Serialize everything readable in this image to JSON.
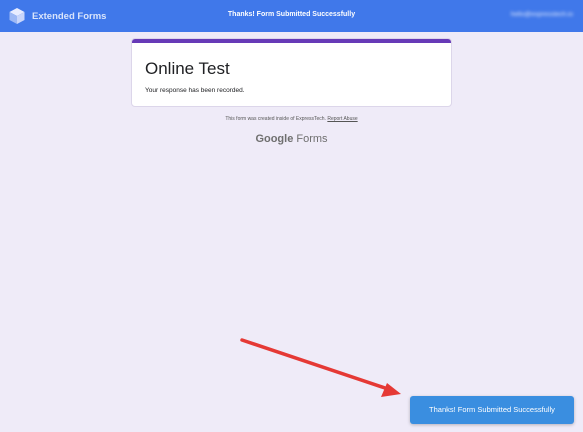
{
  "topbar": {
    "brand_name": "Extended Forms",
    "brand_icon": "cube-logo-icon",
    "title": "Thanks! Form Submitted Successfully",
    "user_email": "hello@expresstech.io"
  },
  "form": {
    "title": "Online Test",
    "confirmation": "Your response has been recorded.",
    "accent_color": "#673ab7"
  },
  "footer": {
    "disclaimer_prefix": "This form was created inside of ExpressTech.",
    "report_abuse": "Report Abuse",
    "google": "Google",
    "forms": "Forms"
  },
  "toast": {
    "message": "Thanks! Form Submitted Successfully"
  },
  "annotation": {
    "arrow_color": "#e53935",
    "arrow_icon": "red-arrow-annotation"
  }
}
